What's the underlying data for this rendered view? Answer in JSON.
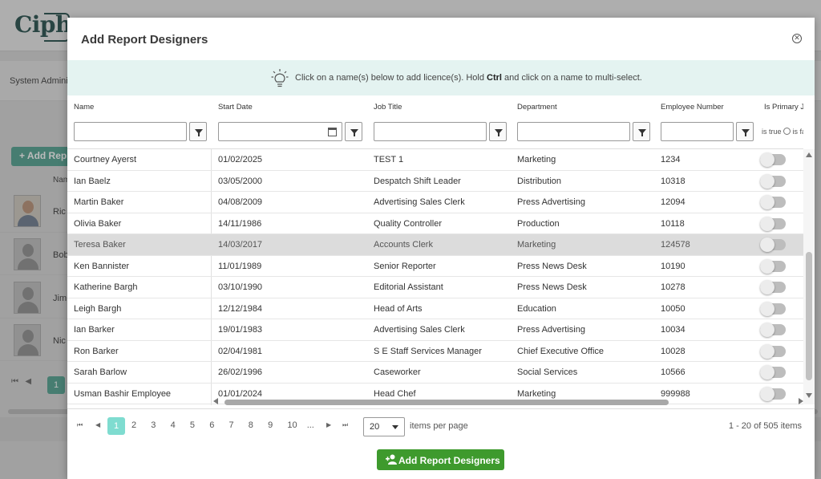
{
  "background": {
    "logo": "Ciphr",
    "system_admin_label": "System Admini",
    "add_button_label": "+ Add Rep",
    "name_col": "Nam",
    "people": [
      "Ric",
      "Bob",
      "Jim",
      "Nic"
    ],
    "page": "1"
  },
  "modal": {
    "title": "Add Report Designers",
    "close_icon": "close-circle-icon",
    "info": {
      "icon": "lightbulb-icon",
      "text_before": "Click on a name(s) below to add licence(s). Hold ",
      "text_bold": "Ctrl",
      "text_after": " and click on a name to multi-select."
    },
    "columns": [
      "Name",
      "Start Date",
      "Job Title",
      "Department",
      "Employee Number",
      "Is Primary Jo"
    ],
    "bool_filter": {
      "true_label": "is true",
      "false_label": "is fa"
    },
    "rows": [
      {
        "name": "Courtney Ayerst",
        "start": "01/02/2025",
        "job": "TEST 1",
        "dept": "Marketing",
        "emp": "1234"
      },
      {
        "name": "Ian Baelz",
        "start": "03/05/2000",
        "job": "Despatch Shift Leader",
        "dept": "Distribution",
        "emp": "10318"
      },
      {
        "name": "Martin Baker",
        "start": "04/08/2009",
        "job": "Advertising Sales Clerk",
        "dept": "Press Advertising",
        "emp": "12094"
      },
      {
        "name": "Olivia Baker",
        "start": "14/11/1986",
        "job": "Quality Controller",
        "dept": "Production",
        "emp": "10118"
      },
      {
        "name": "Teresa Baker",
        "start": "14/03/2017",
        "job": "Accounts Clerk",
        "dept": "Marketing",
        "emp": "124578"
      },
      {
        "name": "Ken Bannister",
        "start": "11/01/1989",
        "job": "Senior Reporter",
        "dept": "Press News Desk",
        "emp": "10190"
      },
      {
        "name": "Katherine Bargh",
        "start": "03/10/1990",
        "job": "Editorial Assistant",
        "dept": "Press News Desk",
        "emp": "10278"
      },
      {
        "name": "Leigh Bargh",
        "start": "12/12/1984",
        "job": "Head of Arts",
        "dept": "Education",
        "emp": "10050"
      },
      {
        "name": "Ian Barker",
        "start": "19/01/1983",
        "job": "Advertising Sales Clerk",
        "dept": "Press Advertising",
        "emp": "10034"
      },
      {
        "name": "Ron Barker",
        "start": "02/04/1981",
        "job": "S E Staff Services Manager",
        "dept": "Chief Executive Office",
        "emp": "10028"
      },
      {
        "name": "Sarah Barlow",
        "start": "26/02/1996",
        "job": "Caseworker",
        "dept": "Social Services",
        "emp": "10566"
      },
      {
        "name": "Usman Bashir Employee",
        "start": "01/01/2024",
        "job": "Head Chef",
        "dept": "Marketing",
        "emp": "999988"
      }
    ],
    "highlight_row": 4,
    "pager": {
      "pages": [
        "1",
        "2",
        "3",
        "4",
        "5",
        "6",
        "7",
        "8",
        "9",
        "10",
        "..."
      ],
      "page_size": "20",
      "items_per_page": "items per page",
      "summary": "1 - 20 of 505 items"
    },
    "add_button_label": "Add Report Designers",
    "accent": "#3e9a2d",
    "active_page_color": "#7fdcd0"
  }
}
